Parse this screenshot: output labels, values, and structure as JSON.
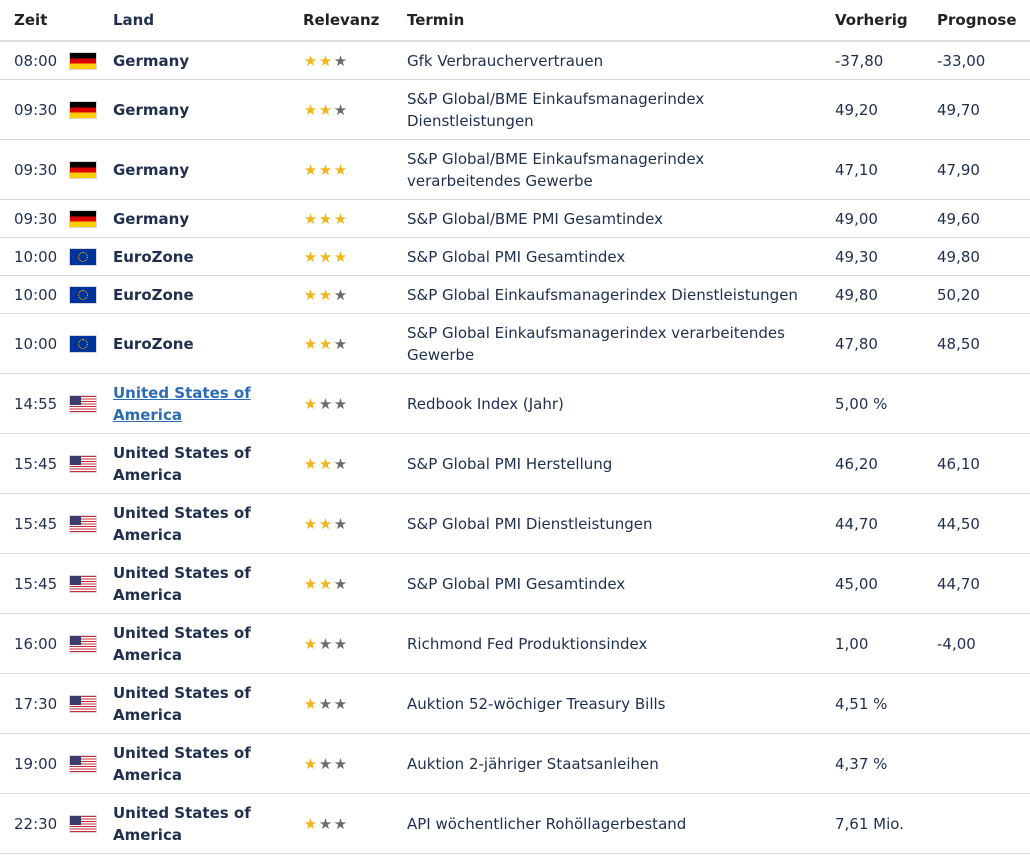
{
  "headers": {
    "time": "Zeit",
    "land": "Land",
    "relevance": "Relevanz",
    "event": "Termin",
    "previous": "Vorherig",
    "forecast": "Prognose"
  },
  "colors": {
    "star_active": "#f2b51c",
    "star_inactive": "#6b6b6b",
    "link": "#2e6bb5",
    "text": "#1f2f4d"
  },
  "rows": [
    {
      "time": "08:00",
      "flag": "germany-flag",
      "land_line1": "Germany",
      "land_line2": "",
      "relevance": 2,
      "event_line1": "Gfk Verbrauchervertrauen",
      "event_line2": "",
      "previous": "-37,80",
      "forecast": "-33,00"
    },
    {
      "time": "09:30",
      "flag": "germany-flag",
      "land_line1": "Germany",
      "land_line2": "",
      "relevance": 2,
      "event_line1": "S&P Global/BME Einkaufsmanagerindex",
      "event_line2": "Dienstleistungen",
      "previous": "49,20",
      "forecast": "49,70"
    },
    {
      "time": "09:30",
      "flag": "germany-flag",
      "land_line1": "Germany",
      "land_line2": "",
      "relevance": 3,
      "event_line1": "S&P Global/BME Einkaufsmanagerindex",
      "event_line2": "verarbeitendes Gewerbe",
      "previous": "47,10",
      "forecast": "47,90"
    },
    {
      "time": "09:30",
      "flag": "germany-flag",
      "land_line1": "Germany",
      "land_line2": "",
      "relevance": 3,
      "event_line1": "S&P Global/BME PMI Gesamtindex",
      "event_line2": "",
      "previous": "49,00",
      "forecast": "49,60"
    },
    {
      "time": "10:00",
      "flag": "eurozone-flag",
      "land_line1": "EuroZone",
      "land_line2": "",
      "relevance": 3,
      "event_line1": "S&P Global PMI Gesamtindex",
      "event_line2": "",
      "previous": "49,30",
      "forecast": "49,80"
    },
    {
      "time": "10:00",
      "flag": "eurozone-flag",
      "land_line1": "EuroZone",
      "land_line2": "",
      "relevance": 2,
      "event_line1": "S&P Global Einkaufsmanagerindex Dienstleistungen",
      "event_line2": "",
      "previous": "49,80",
      "forecast": "50,20"
    },
    {
      "time": "10:00",
      "flag": "eurozone-flag",
      "land_line1": "EuroZone",
      "land_line2": "",
      "relevance": 2,
      "event_line1": "S&P Global Einkaufsmanagerindex verarbeitendes",
      "event_line2": "Gewerbe",
      "previous": "47,80",
      "forecast": "48,50"
    },
    {
      "time": "14:55",
      "flag": "usa-flag",
      "land_line1": "United States of",
      "land_line2": "America",
      "relevance": 1,
      "event_line1": "Redbook Index (Jahr)",
      "event_line2": "",
      "previous": "5,00 %",
      "forecast": ""
    },
    {
      "time": "15:45",
      "flag": "usa-flag",
      "land_line1": "United States of",
      "land_line2": "America",
      "relevance": 2,
      "event_line1": "S&P Global PMI Herstellung",
      "event_line2": "",
      "previous": "46,20",
      "forecast": "46,10"
    },
    {
      "time": "15:45",
      "flag": "usa-flag",
      "land_line1": "United States of",
      "land_line2": "America",
      "relevance": 2,
      "event_line1": "S&P Global PMI Dienstleistungen",
      "event_line2": "",
      "previous": "44,70",
      "forecast": "44,50"
    },
    {
      "time": "15:45",
      "flag": "usa-flag",
      "land_line1": "United States of",
      "land_line2": "America",
      "relevance": 2,
      "event_line1": "S&P Global PMI Gesamtindex",
      "event_line2": "",
      "previous": "45,00",
      "forecast": "44,70"
    },
    {
      "time": "16:00",
      "flag": "usa-flag",
      "land_line1": "United States of",
      "land_line2": "America",
      "relevance": 1,
      "event_line1": "Richmond Fed Produktionsindex",
      "event_line2": "",
      "previous": "1,00",
      "forecast": "-4,00"
    },
    {
      "time": "17:30",
      "flag": "usa-flag",
      "land_line1": "United States of",
      "land_line2": "America",
      "relevance": 1,
      "event_line1": "Auktion 52-wöchiger Treasury Bills",
      "event_line2": "",
      "previous": "4,51 %",
      "forecast": ""
    },
    {
      "time": "19:00",
      "flag": "usa-flag",
      "land_line1": "United States of",
      "land_line2": "America",
      "relevance": 1,
      "event_line1": "Auktion 2-jähriger Staatsanleihen",
      "event_line2": "",
      "previous": "4,37 %",
      "forecast": ""
    },
    {
      "time": "22:30",
      "flag": "usa-flag",
      "land_line1": "United States of",
      "land_line2": "America",
      "relevance": 1,
      "event_line1": "API wöchentlicher Rohöllagerbestand",
      "event_line2": "",
      "previous": "7,61 Mio.",
      "forecast": ""
    }
  ]
}
